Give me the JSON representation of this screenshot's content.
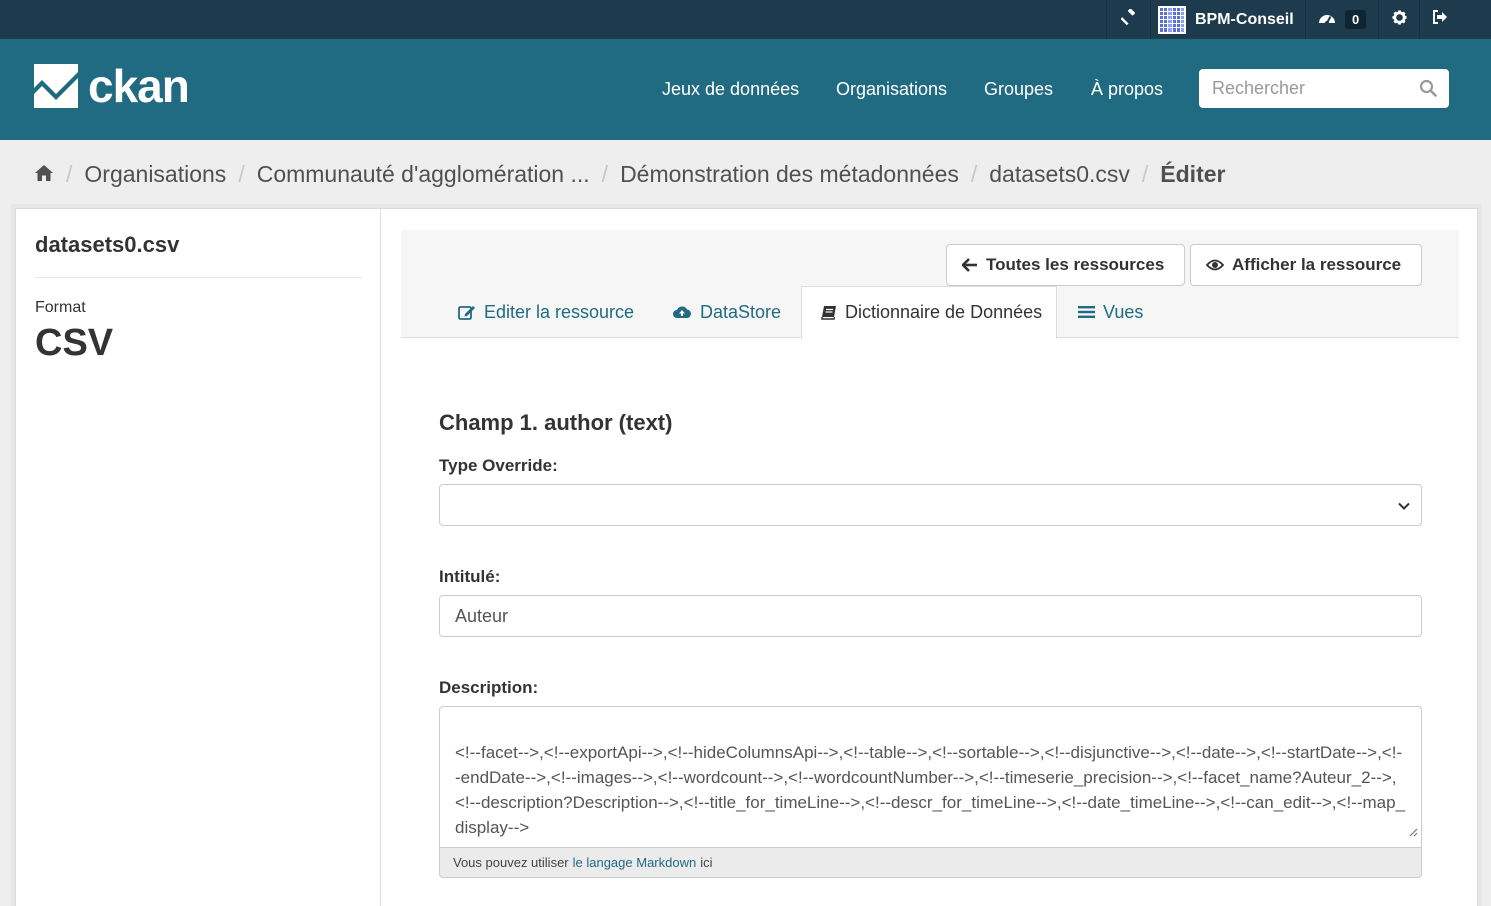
{
  "account": {
    "user_name": "BPM-Conseil",
    "dashboard_count": "0"
  },
  "brand": {
    "name": "ckan",
    "color": "#206b82"
  },
  "nav": {
    "items": [
      "Jeux de données",
      "Organisations",
      "Groupes",
      "À propos"
    ]
  },
  "search": {
    "placeholder": "Rechercher"
  },
  "breadcrumb": {
    "items": [
      "Organisations",
      "Communauté d'agglomération ...",
      "Démonstration des métadonnées",
      "datasets0.csv"
    ],
    "active": "Éditer"
  },
  "sidebar": {
    "title": "datasets0.csv",
    "format_label": "Format",
    "format_value": "CSV"
  },
  "header": {
    "buttons": {
      "all_resources": "Toutes les ressources",
      "view_resource": "Afficher la ressource"
    },
    "tabs": [
      "Editer la ressource",
      "DataStore",
      "Dictionnaire de Données",
      "Vues"
    ],
    "active_tab": "Dictionnaire de Données"
  },
  "form": {
    "field_title": "Champ 1. author (text)",
    "type_override_label": "Type Override:",
    "type_override_value": "",
    "label_label": "Intitulé:",
    "label_value": "Auteur",
    "description_label": "Description:",
    "description_value": "<!--facet-->,<!--exportApi-->,<!--hideColumnsApi-->,<!--table-->,<!--sortable-->,<!--disjunctive-->,<!--date-->,<!--startDate-->,<!--endDate-->,<!--images-->,<!--wordcount-->,<!--wordcountNumber-->,<!--timeserie_precision-->,<!--facet_name?Auteur_2-->,<!--description?Description-->,<!--title_for_timeLine-->,<!--descr_for_timeLine-->,<!--date_timeLine-->,<!--can_edit-->,<!--map_display-->",
    "help": {
      "prefix": "Vous pouvez utiliser",
      "link": "le langage Markdown",
      "suffix": "ici"
    }
  }
}
